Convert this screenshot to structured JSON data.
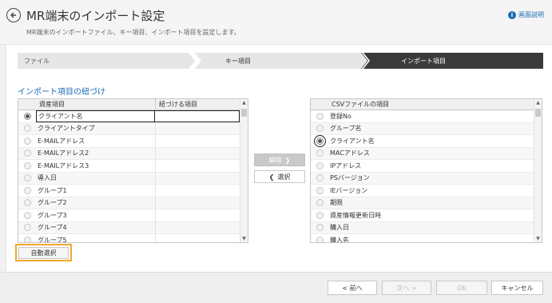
{
  "header": {
    "title": "MR端末のインポート設定",
    "description": "MR端末のインポートファイル、キー項目、インポート項目を設定します。",
    "help_label": "画面説明",
    "help_icon": "info-icon"
  },
  "steps": [
    {
      "label": "ファイル",
      "state": "done"
    },
    {
      "label": "キー項目",
      "state": "done"
    },
    {
      "label": "インポート項目",
      "state": "active"
    }
  ],
  "section_title": "インポート項目の紐づけ",
  "left_grid": {
    "headers": [
      "資産項目",
      "紐づける項目"
    ],
    "rows": [
      {
        "name": "クライアント名",
        "linked": "",
        "selected": true
      },
      {
        "name": "クライアントタイプ",
        "linked": "",
        "selected": false
      },
      {
        "name": "E-MAILアドレス",
        "linked": "",
        "selected": false
      },
      {
        "name": "E-MAILアドレス2",
        "linked": "",
        "selected": false
      },
      {
        "name": "E-MAILアドレス3",
        "linked": "",
        "selected": false
      },
      {
        "name": "導入日",
        "linked": "",
        "selected": false
      },
      {
        "name": "グループ1",
        "linked": "",
        "selected": false
      },
      {
        "name": "グループ2",
        "linked": "",
        "selected": false
      },
      {
        "name": "グループ3",
        "linked": "",
        "selected": false
      },
      {
        "name": "グループ4",
        "linked": "",
        "selected": false
      },
      {
        "name": "グループ5",
        "linked": "",
        "selected": false
      }
    ]
  },
  "right_grid": {
    "headers": [
      "CSVファイルの項目"
    ],
    "rows": [
      {
        "name": "登録No",
        "selected": false
      },
      {
        "name": "グループ名",
        "selected": false
      },
      {
        "name": "クライアント名",
        "selected": true
      },
      {
        "name": "MACアドレス",
        "selected": false
      },
      {
        "name": "IPアドレス",
        "selected": false
      },
      {
        "name": "PSバージョン",
        "selected": false
      },
      {
        "name": "IEバージョン",
        "selected": false
      },
      {
        "name": "期限",
        "selected": false
      },
      {
        "name": "資産情報更新日時",
        "selected": false
      },
      {
        "name": "購入日",
        "selected": false
      },
      {
        "name": "購入先",
        "selected": false
      }
    ]
  },
  "middle_buttons": {
    "release_label": "解除",
    "select_label": "選択"
  },
  "auto_select_label": "自動選択",
  "footer": {
    "prev_label": "< 前へ",
    "next_label": "次へ >",
    "ok_label": "OK",
    "cancel_label": "キャンセル"
  },
  "colors": {
    "accent": "#1a6bb5",
    "active_step": "#3a3a3a",
    "highlight": "#f0a830"
  }
}
